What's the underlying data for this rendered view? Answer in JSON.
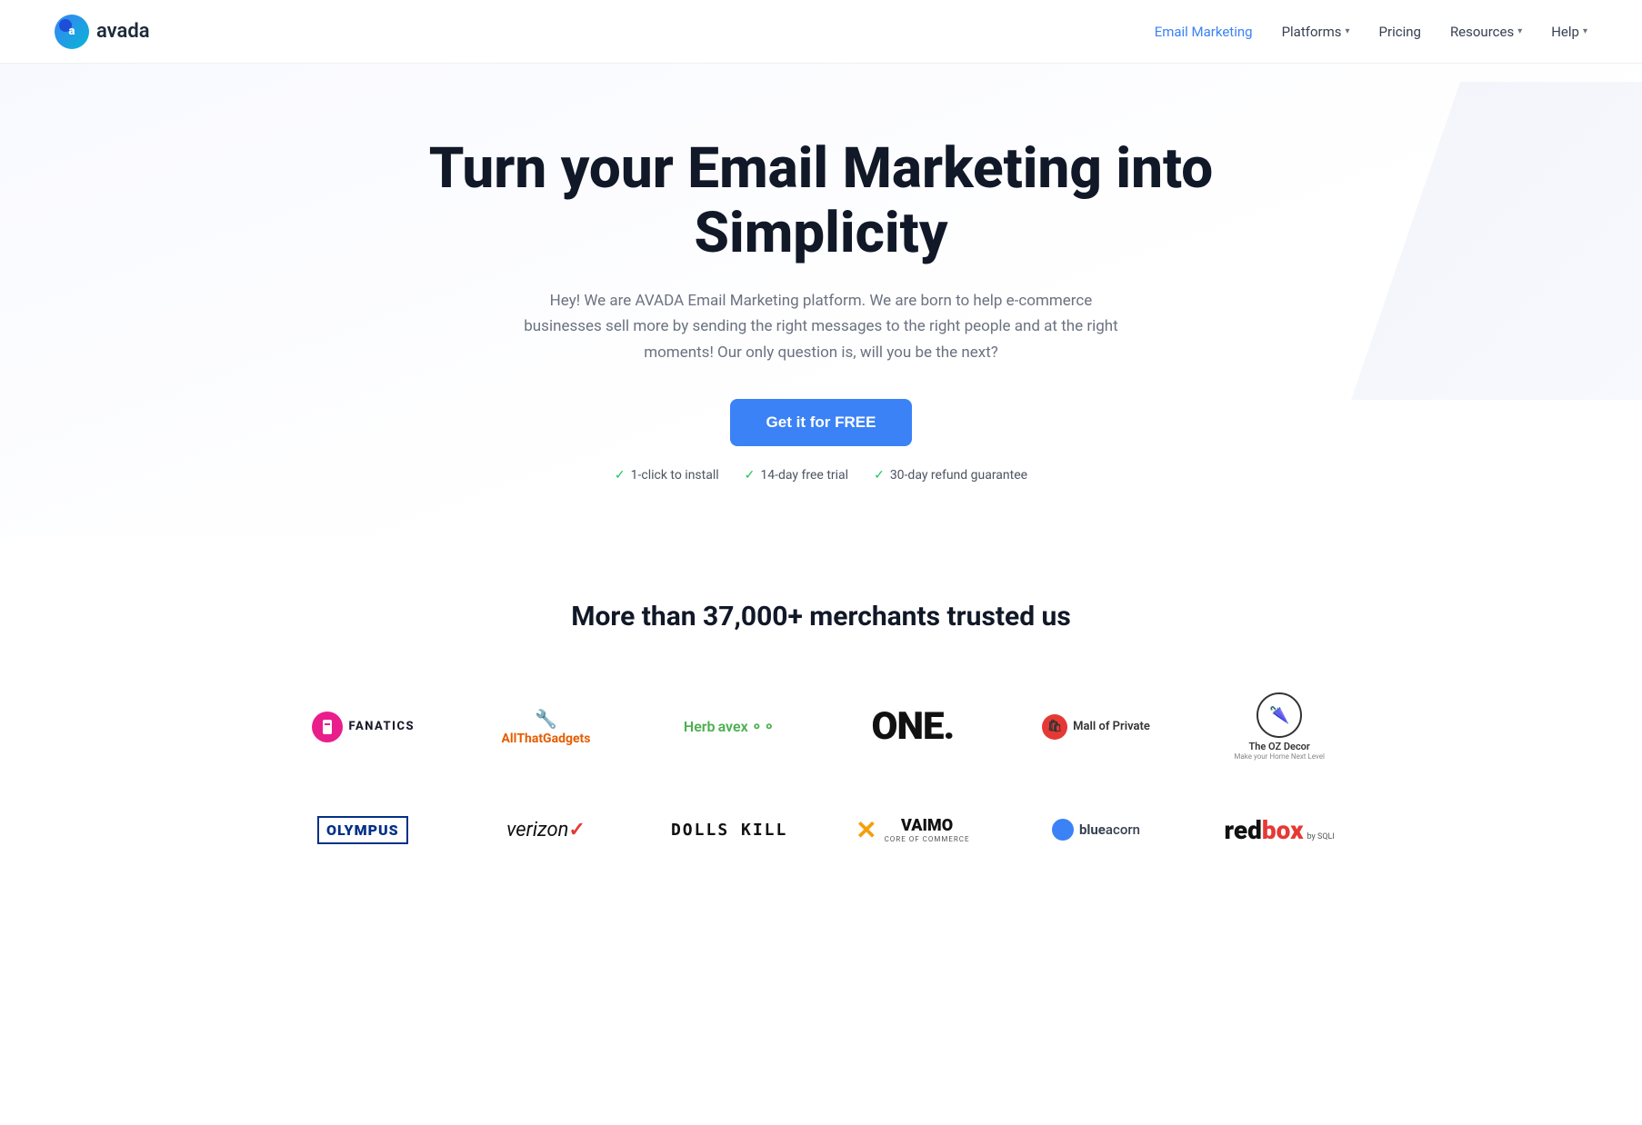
{
  "nav": {
    "logo_text": "avada",
    "logo_letter": "a",
    "links": [
      {
        "label": "Email Marketing",
        "active": true,
        "has_dropdown": false
      },
      {
        "label": "Platforms",
        "active": false,
        "has_dropdown": true
      },
      {
        "label": "Pricing",
        "active": false,
        "has_dropdown": false
      },
      {
        "label": "Resources",
        "active": false,
        "has_dropdown": true
      },
      {
        "label": "Help",
        "active": false,
        "has_dropdown": true
      }
    ]
  },
  "hero": {
    "heading": "Turn your Email Marketing into Simplicity",
    "subheading": "Hey! We are AVADA Email Marketing platform. We are born to help e-commerce businesses sell more by sending the right messages to the right people and at the right moments! Our only question is, will you be the next?",
    "cta_label": "Get it for FREE",
    "badges": [
      {
        "text": "1-click to install"
      },
      {
        "text": "14-day free trial"
      },
      {
        "text": "30-day refund guarantee"
      }
    ]
  },
  "merchants": {
    "heading": "More than 37,000+ merchants trusted us",
    "logos": [
      {
        "id": "fanatics",
        "name": "Fanatics",
        "text": "FANATICS"
      },
      {
        "id": "allthat",
        "name": "AllThatGadgets",
        "text": "AllThatGadgets"
      },
      {
        "id": "herbavex",
        "name": "Herbavex",
        "text": "Herbavex"
      },
      {
        "id": "one",
        "name": "ONE.",
        "text": "ONE."
      },
      {
        "id": "mall",
        "name": "Mall of Private",
        "text": "Mall of Private"
      },
      {
        "id": "oz",
        "name": "The OZ Decor",
        "text": "The OZ Decor"
      },
      {
        "id": "olympus",
        "name": "OLYMPUS",
        "text": "OLYMPUS"
      },
      {
        "id": "verizon",
        "name": "verizon",
        "text": "verizon"
      },
      {
        "id": "dolls",
        "name": "DOLLS KILL",
        "text": "DOLLS KILL"
      },
      {
        "id": "vaimo",
        "name": "VAIMO",
        "text": "VAIMO",
        "subtitle": "CORE OF COMMERCE"
      },
      {
        "id": "blueacorn",
        "name": "blue acorn",
        "text": "blue acorn"
      },
      {
        "id": "redbox",
        "name": "redbox by SQLI",
        "text": "redbox",
        "suffix": "by SQLI"
      }
    ]
  }
}
